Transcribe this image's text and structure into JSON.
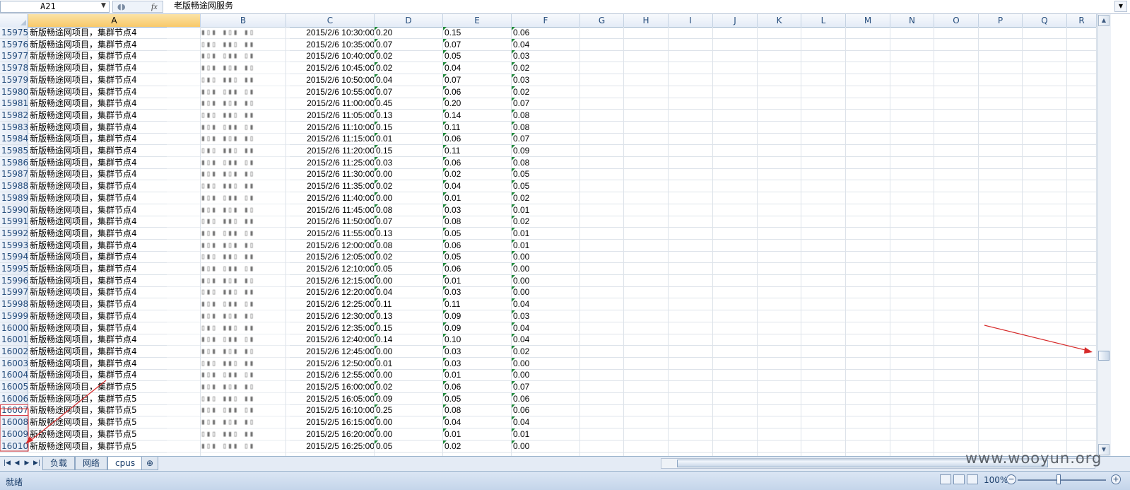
{
  "formula_bar": {
    "name_box": "A21",
    "fx": "fx",
    "content": "老版畅途网服务"
  },
  "columns": [
    "A",
    "B",
    "C",
    "D",
    "E",
    "F",
    "G",
    "H",
    "I",
    "J",
    "K",
    "L",
    "M",
    "N",
    "O",
    "P",
    "Q",
    "R"
  ],
  "rows": [
    {
      "n": "15975",
      "a": "新版畅途网项目，集群节点4",
      "b": "▮▯▮ ▮▯▮ ▮▯",
      "c": "2015/2/6 10:30:00",
      "d": "0.20",
      "e": "0.15",
      "f": "0.06"
    },
    {
      "n": "15976",
      "a": "新版畅途网项目，集群节点4",
      "b": "▯▮▯ ▮▮▯ ▮▮",
      "c": "2015/2/6 10:35:00",
      "d": "0.07",
      "e": "0.07",
      "f": "0.04"
    },
    {
      "n": "15977",
      "a": "新版畅途网项目，集群节点4",
      "b": "▮▯▮ ▯▮▮ ▯▮",
      "c": "2015/2/6 10:40:00",
      "d": "0.02",
      "e": "0.05",
      "f": "0.03"
    },
    {
      "n": "15978",
      "a": "新版畅途网项目，集群节点4",
      "b": "▮▯▮ ▮▯▮ ▮▯",
      "c": "2015/2/6 10:45:00",
      "d": "0.02",
      "e": "0.04",
      "f": "0.02"
    },
    {
      "n": "15979",
      "a": "新版畅途网项目，集群节点4",
      "b": "▯▮▯ ▮▮▯ ▮▮",
      "c": "2015/2/6 10:50:00",
      "d": "0.04",
      "e": "0.07",
      "f": "0.03"
    },
    {
      "n": "15980",
      "a": "新版畅途网项目，集群节点4",
      "b": "▮▯▮ ▯▮▮ ▯▮",
      "c": "2015/2/6 10:55:00",
      "d": "0.07",
      "e": "0.06",
      "f": "0.02"
    },
    {
      "n": "15981",
      "a": "新版畅途网项目，集群节点4",
      "b": "▮▯▮ ▮▯▮ ▮▯",
      "c": "2015/2/6 11:00:00",
      "d": "0.45",
      "e": "0.20",
      "f": "0.07"
    },
    {
      "n": "15982",
      "a": "新版畅途网项目，集群节点4",
      "b": "▯▮▯ ▮▮▯ ▮▮",
      "c": "2015/2/6 11:05:00",
      "d": "0.13",
      "e": "0.14",
      "f": "0.08"
    },
    {
      "n": "15983",
      "a": "新版畅途网项目，集群节点4",
      "b": "▮▯▮ ▯▮▮ ▯▮",
      "c": "2015/2/6 11:10:00",
      "d": "0.15",
      "e": "0.11",
      "f": "0.08"
    },
    {
      "n": "15984",
      "a": "新版畅途网项目，集群节点4",
      "b": "▮▯▮ ▮▯▮ ▮▯",
      "c": "2015/2/6 11:15:00",
      "d": "0.01",
      "e": "0.06",
      "f": "0.07"
    },
    {
      "n": "15985",
      "a": "新版畅途网项目，集群节点4",
      "b": "▯▮▯ ▮▮▯ ▮▮",
      "c": "2015/2/6 11:20:00",
      "d": "0.15",
      "e": "0.11",
      "f": "0.09"
    },
    {
      "n": "15986",
      "a": "新版畅途网项目，集群节点4",
      "b": "▮▯▮ ▯▮▮ ▯▮",
      "c": "2015/2/6 11:25:00",
      "d": "0.03",
      "e": "0.06",
      "f": "0.08"
    },
    {
      "n": "15987",
      "a": "新版畅途网项目，集群节点4",
      "b": "▮▯▮ ▮▯▮ ▮▯",
      "c": "2015/2/6 11:30:00",
      "d": "0.00",
      "e": "0.02",
      "f": "0.05"
    },
    {
      "n": "15988",
      "a": "新版畅途网项目，集群节点4",
      "b": "▯▮▯ ▮▮▯ ▮▮",
      "c": "2015/2/6 11:35:00",
      "d": "0.02",
      "e": "0.04",
      "f": "0.05"
    },
    {
      "n": "15989",
      "a": "新版畅途网项目，集群节点4",
      "b": "▮▯▮ ▯▮▮ ▯▮",
      "c": "2015/2/6 11:40:00",
      "d": "0.00",
      "e": "0.01",
      "f": "0.02"
    },
    {
      "n": "15990",
      "a": "新版畅途网项目，集群节点4",
      "b": "▮▯▮ ▮▯▮ ▮▯",
      "c": "2015/2/6 11:45:00",
      "d": "0.08",
      "e": "0.03",
      "f": "0.01"
    },
    {
      "n": "15991",
      "a": "新版畅途网项目，集群节点4",
      "b": "▯▮▯ ▮▮▯ ▮▮",
      "c": "2015/2/6 11:50:00",
      "d": "0.07",
      "e": "0.08",
      "f": "0.02"
    },
    {
      "n": "15992",
      "a": "新版畅途网项目，集群节点4",
      "b": "▮▯▮ ▯▮▮ ▯▮",
      "c": "2015/2/6 11:55:00",
      "d": "0.13",
      "e": "0.05",
      "f": "0.01"
    },
    {
      "n": "15993",
      "a": "新版畅途网项目，集群节点4",
      "b": "▮▯▮ ▮▯▮ ▮▯",
      "c": "2015/2/6 12:00:00",
      "d": "0.08",
      "e": "0.06",
      "f": "0.01"
    },
    {
      "n": "15994",
      "a": "新版畅途网项目，集群节点4",
      "b": "▯▮▯ ▮▮▯ ▮▮",
      "c": "2015/2/6 12:05:00",
      "d": "0.02",
      "e": "0.05",
      "f": "0.00"
    },
    {
      "n": "15995",
      "a": "新版畅途网项目，集群节点4",
      "b": "▮▯▮ ▯▮▮ ▯▮",
      "c": "2015/2/6 12:10:00",
      "d": "0.05",
      "e": "0.06",
      "f": "0.00"
    },
    {
      "n": "15996",
      "a": "新版畅途网项目，集群节点4",
      "b": "▮▯▮ ▮▯▮ ▮▯",
      "c": "2015/2/6 12:15:00",
      "d": "0.00",
      "e": "0.01",
      "f": "0.00"
    },
    {
      "n": "15997",
      "a": "新版畅途网项目，集群节点4",
      "b": "▯▮▯ ▮▮▯ ▮▮",
      "c": "2015/2/6 12:20:00",
      "d": "0.04",
      "e": "0.03",
      "f": "0.00"
    },
    {
      "n": "15998",
      "a": "新版畅途网项目，集群节点4",
      "b": "▮▯▮ ▯▮▮ ▯▮",
      "c": "2015/2/6 12:25:00",
      "d": "0.11",
      "e": "0.11",
      "f": "0.04"
    },
    {
      "n": "15999",
      "a": "新版畅途网项目，集群节点4",
      "b": "▮▯▮ ▮▯▮ ▮▯",
      "c": "2015/2/6 12:30:00",
      "d": "0.13",
      "e": "0.09",
      "f": "0.03"
    },
    {
      "n": "16000",
      "a": "新版畅途网项目，集群节点4",
      "b": "▯▮▯ ▮▮▯ ▮▮",
      "c": "2015/2/6 12:35:00",
      "d": "0.15",
      "e": "0.09",
      "f": "0.04"
    },
    {
      "n": "16001",
      "a": "新版畅途网项目，集群节点4",
      "b": "▮▯▮ ▯▮▮ ▯▮",
      "c": "2015/2/6 12:40:00",
      "d": "0.14",
      "e": "0.10",
      "f": "0.04"
    },
    {
      "n": "16002",
      "a": "新版畅途网项目，集群节点4",
      "b": "▮▯▮ ▮▯▮ ▮▯",
      "c": "2015/2/6 12:45:00",
      "d": "0.00",
      "e": "0.03",
      "f": "0.02"
    },
    {
      "n": "16003",
      "a": "新版畅途网项目，集群节点4",
      "b": "▯▮▯ ▮▮▯ ▮▮",
      "c": "2015/2/6 12:50:00",
      "d": "0.01",
      "e": "0.03",
      "f": "0.00"
    },
    {
      "n": "16004",
      "a": "新版畅途网项目，集群节点4",
      "b": "▮▯▮ ▯▮▮ ▯▮",
      "c": "2015/2/6 12:55:00",
      "d": "0.00",
      "e": "0.01",
      "f": "0.00"
    },
    {
      "n": "16005",
      "a": "新版畅途网项目，集群节点5",
      "b": "▮▯▮ ▮▯▮ ▮▯",
      "c": "2015/2/5 16:00:00",
      "d": "0.02",
      "e": "0.06",
      "f": "0.07"
    },
    {
      "n": "16006",
      "a": "新版畅途网项目，集群节点5",
      "b": "▯▮▯ ▮▮▯ ▮▮",
      "c": "2015/2/5 16:05:00",
      "d": "0.09",
      "e": "0.05",
      "f": "0.06"
    },
    {
      "n": "16007",
      "a": "新版畅途网项目，集群节点5",
      "b": "▮▯▮ ▯▮▮ ▯▮",
      "c": "2015/2/5 16:10:00",
      "d": "0.25",
      "e": "0.08",
      "f": "0.06"
    },
    {
      "n": "16008",
      "a": "新版畅途网项目，集群节点5",
      "b": "▮▯▮ ▮▯▮ ▮▯",
      "c": "2015/2/5 16:15:00",
      "d": "0.00",
      "e": "0.04",
      "f": "0.04"
    },
    {
      "n": "16009",
      "a": "新版畅途网项目，集群节点5",
      "b": "▯▮▯ ▮▮▯ ▮▮",
      "c": "2015/2/5 16:20:00",
      "d": "0.00",
      "e": "0.01",
      "f": "0.01"
    },
    {
      "n": "16010",
      "a": "新版畅途网项目，集群节点5",
      "b": "▮▯▮ ▯▮▮ ▯▮",
      "c": "2015/2/5 16:25:00",
      "d": "0.05",
      "e": "0.02",
      "f": "0.00"
    }
  ],
  "sheets": [
    "负载",
    "网络",
    "cpus"
  ],
  "active_sheet": "cpus",
  "status": {
    "ready": "就绪",
    "zoom": "100%"
  },
  "watermark": "www.wooyun.org",
  "colors": {
    "accent": "#274e7d",
    "selected_header": "#f8c96a",
    "annotation_arrow": "#d62a2a",
    "number_flag": "#1f8a3a"
  }
}
